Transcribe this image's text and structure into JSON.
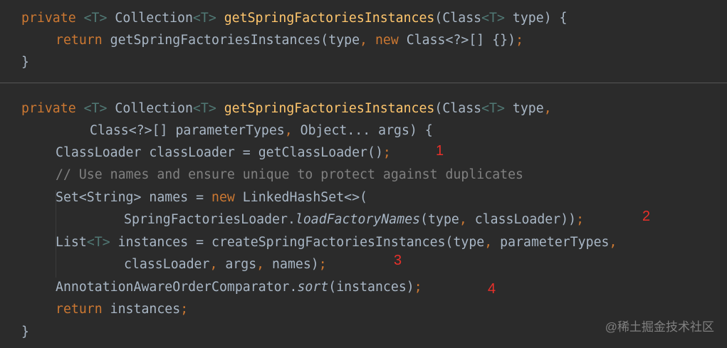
{
  "block1": {
    "line1": {
      "kw_private": "private",
      "t1": "<T>",
      "collection": " Collection",
      "t2": "<T>",
      "fn": "getSpringFactoriesInstances",
      "p1": "(Class",
      "t3": "<T>",
      "p2": " type) {"
    },
    "line2": {
      "kw_return": "return",
      "mid": " getSpringFactoriesInstances(type",
      "comma": ",",
      "kw_new": "new",
      "rest": " Class<?>[] {})",
      "semi": ";"
    },
    "line3": "}"
  },
  "block2": {
    "l1": {
      "kw_private": "private",
      "t1": "<T>",
      "collection": " Collection",
      "t2": "<T>",
      "fn": "getSpringFactoriesInstances",
      "p1": "(Class",
      "t3": "<T>",
      "p2": " type",
      "comma": ","
    },
    "l2": {
      "a": "Class<?>[] parameterTypes",
      "c1": ",",
      "b": " Object... args) {"
    },
    "l3": {
      "text": "ClassLoader classLoader = getClassLoader()",
      "semi": ";"
    },
    "l4": "// Use names and ensure unique to protect against duplicates",
    "l5": {
      "a": "Set<String> names = ",
      "kw_new": "new",
      "b": " LinkedHashSet<>("
    },
    "l6": {
      "a": "SpringFactoriesLoader.",
      "it": "loadFactoryNames",
      "b": "(type",
      "c1": ",",
      "c": " classLoader))",
      "semi": ";"
    },
    "l7": {
      "a": "List",
      "t": "<T>",
      "b": " instances = createSpringFactoriesInstances(type",
      "c1": ",",
      "c": " parameterTypes",
      "c2": ","
    },
    "l8": {
      "a": "classLoader",
      "c1": ",",
      "b": " args",
      "c2": ",",
      "c": " names)",
      "semi": ";"
    },
    "l9": {
      "a": "AnnotationAwareOrderComparator.",
      "it": "sort",
      "b": "(instances)",
      "semi": ";"
    },
    "l10": {
      "kw_return": "return",
      "b": " instances",
      "semi": ";"
    },
    "l11": "}"
  },
  "annotations": [
    "1",
    "2",
    "3",
    "4"
  ],
  "watermark": "@稀土掘金技术社区",
  "colors": {
    "background": "#2b2b2b",
    "keyword": "#cc7832",
    "method": "#ffc66d",
    "generic": "#507874",
    "comment": "#808080",
    "text": "#a9b7c6",
    "annotation": "#e8302a"
  }
}
